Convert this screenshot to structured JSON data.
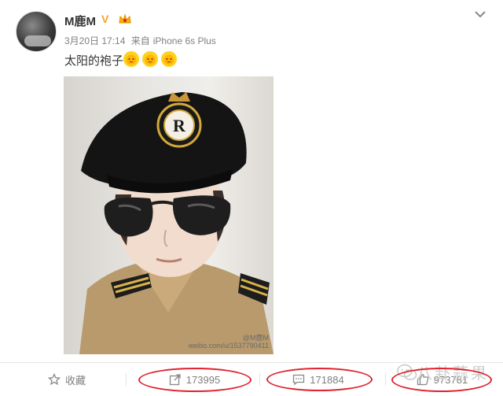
{
  "user": {
    "name": "M鹿M",
    "verified_badge": "V"
  },
  "post": {
    "date": "3月20日 17:14",
    "via_prefix": "来自",
    "device": "iPhone 6s Plus",
    "text": "太阳的袍子",
    "emoji": [
      "sun-icon",
      "sun-icon",
      "sun-icon"
    ]
  },
  "photo": {
    "watermark_line1": "@M鹿M",
    "watermark_line2": "weibo.com/u/1537790411",
    "cap_letter": "R"
  },
  "actions": {
    "favorite_label": "收藏",
    "repost_count": "173995",
    "comment_count": "171884",
    "like_count": "973781"
  },
  "overlay": {
    "brand_text": "八卦蒜果"
  },
  "colors": {
    "annotation_oval": "#e0222e",
    "verified": "#f5a623",
    "meta_text": "#808080"
  }
}
